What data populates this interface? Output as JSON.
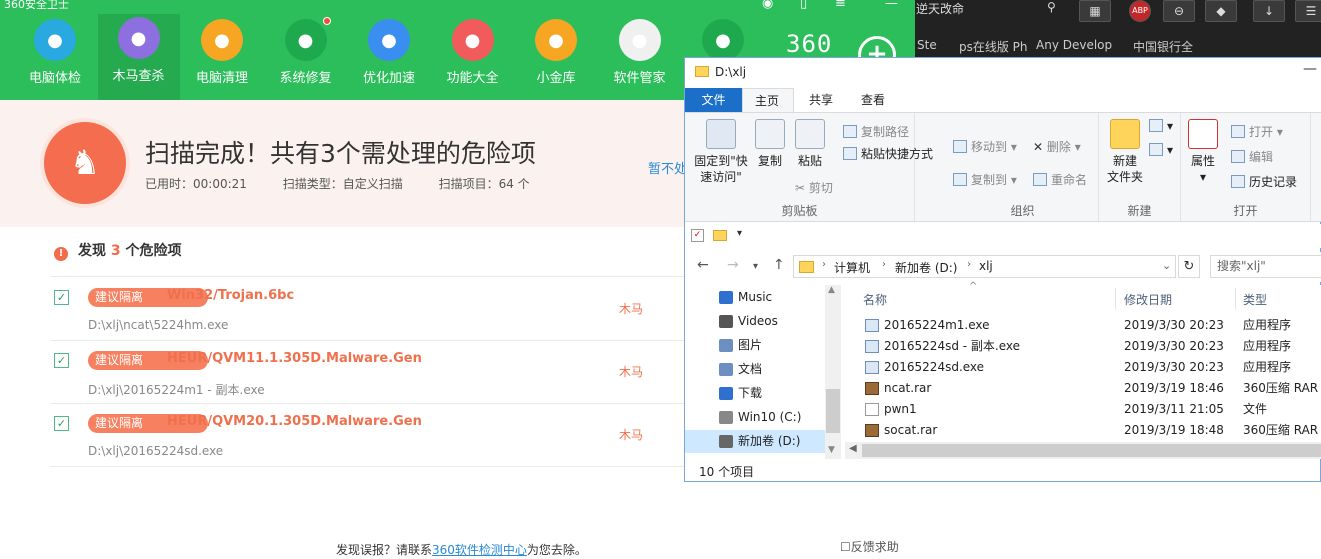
{
  "app360": {
    "title": "360安全卫士",
    "nav": [
      {
        "label": "电脑体检",
        "icon": "monitor-icon",
        "color": "#2aa8e0"
      },
      {
        "label": "木马查杀",
        "icon": "horse-icon",
        "color": "#8d6fe0"
      },
      {
        "label": "电脑清理",
        "icon": "broom-icon",
        "color": "#f6a623"
      },
      {
        "label": "系统修复",
        "icon": "shield-icon",
        "color": "#1fa94e"
      },
      {
        "label": "优化加速",
        "icon": "rocket-icon",
        "color": "#3a8ef0"
      },
      {
        "label": "功能大全",
        "icon": "grid-icon",
        "color": "#f25b5b"
      },
      {
        "label": "小金库",
        "icon": "moneybag-icon",
        "color": "#f6a623"
      },
      {
        "label": "软件管家",
        "icon": "appstore-icon",
        "color": "#f0f0f0"
      },
      {
        "label": "",
        "icon": "gamepad-icon",
        "color": "#1fa94e"
      }
    ],
    "brand": "360",
    "hero": {
      "headline": "扫描完成！共有3个需处理的危险项",
      "elapsed": "已用时：00:00:21",
      "scan_type": "扫描类型：自定义扫描",
      "scan_items": "扫描项目：64 个",
      "pause_link": "暂不处"
    },
    "found": {
      "prefix": "发现 ",
      "count": "3",
      "suffix": " 个危险项"
    },
    "threats": [
      {
        "tag": "建议隔离",
        "name": "Win32/Trojan.6bc",
        "path": "D:\\xlj\\ncat\\5224hm.exe",
        "type": "木马"
      },
      {
        "tag": "建议隔离",
        "name": "HEUR/QVM11.1.305D.Malware.Gen",
        "path": "D:\\xlj\\20165224m1 - 副本.exe",
        "type": "木马"
      },
      {
        "tag": "建议隔离",
        "name": "HEUR/QVM20.1.305D.Malware.Gen",
        "path": "D:\\xlj\\20165224sd.exe",
        "type": "木马"
      }
    ],
    "footer": {
      "before": "发现误报？请联系",
      "link": "360软件检测中心",
      "after": "为您去除。"
    },
    "feedback": "反馈求助"
  },
  "browser": {
    "address": "逆天改命",
    "buttons": [
      "▦",
      "ABP",
      "⊖",
      "◆",
      "↓",
      "☰"
    ],
    "bookmarks": [
      "Ste",
      "ps在线版 Ph",
      "Any Develop",
      "中国银行全"
    ]
  },
  "explorer": {
    "title": "D:\\xlj",
    "tabs": [
      "文件",
      "主页",
      "共享",
      "查看"
    ],
    "ribbon": {
      "pin": "固定到\"快速访问\"",
      "copy": "复制",
      "paste": "粘贴",
      "copy_path": "复制路径",
      "paste_shortcut": "粘贴快捷方式",
      "cut": "剪切",
      "group_clipboard": "剪贴板",
      "move_to": "移动到",
      "copy_to": "复制到",
      "delete": "删除",
      "rename": "重命名",
      "group_organize": "组织",
      "new_folder": "新建\n文件夹",
      "group_new": "新建",
      "properties": "属性",
      "open": "打开",
      "edit": "编辑",
      "history": "历史记录",
      "group_open": "打开"
    },
    "path": [
      "计算机",
      "新加卷 (D:)",
      "xlj"
    ],
    "search_placeholder": "搜索\"xlj\"",
    "tree": [
      {
        "label": "Music",
        "color": "#2f6fd0"
      },
      {
        "label": "Videos",
        "color": "#555"
      },
      {
        "label": "图片",
        "color": "#6a8fc0"
      },
      {
        "label": "文档",
        "color": "#6a8fc0"
      },
      {
        "label": "下载",
        "color": "#2f6fd0"
      },
      {
        "label": "Win10 (C:)",
        "color": "#888"
      },
      {
        "label": "新加卷 (D:)",
        "color": "#666"
      }
    ],
    "columns": [
      "名称",
      "修改日期",
      "类型"
    ],
    "files": [
      {
        "name": "20165224m1.exe",
        "date": "2019/3/30 20:23",
        "type": "应用程序",
        "kind": "exe"
      },
      {
        "name": "20165224sd - 副本.exe",
        "date": "2019/3/30 20:23",
        "type": "应用程序",
        "kind": "exe"
      },
      {
        "name": "20165224sd.exe",
        "date": "2019/3/30 20:23",
        "type": "应用程序",
        "kind": "exe"
      },
      {
        "name": "ncat.rar",
        "date": "2019/3/19 18:46",
        "type": "360压缩 RAR 文",
        "kind": "rar"
      },
      {
        "name": "pwn1",
        "date": "2019/3/11 21:05",
        "type": "文件",
        "kind": "file"
      },
      {
        "name": "socat.rar",
        "date": "2019/3/19 18:48",
        "type": "360压缩 RAR 文",
        "kind": "rar"
      }
    ],
    "status": "10 个项目"
  }
}
